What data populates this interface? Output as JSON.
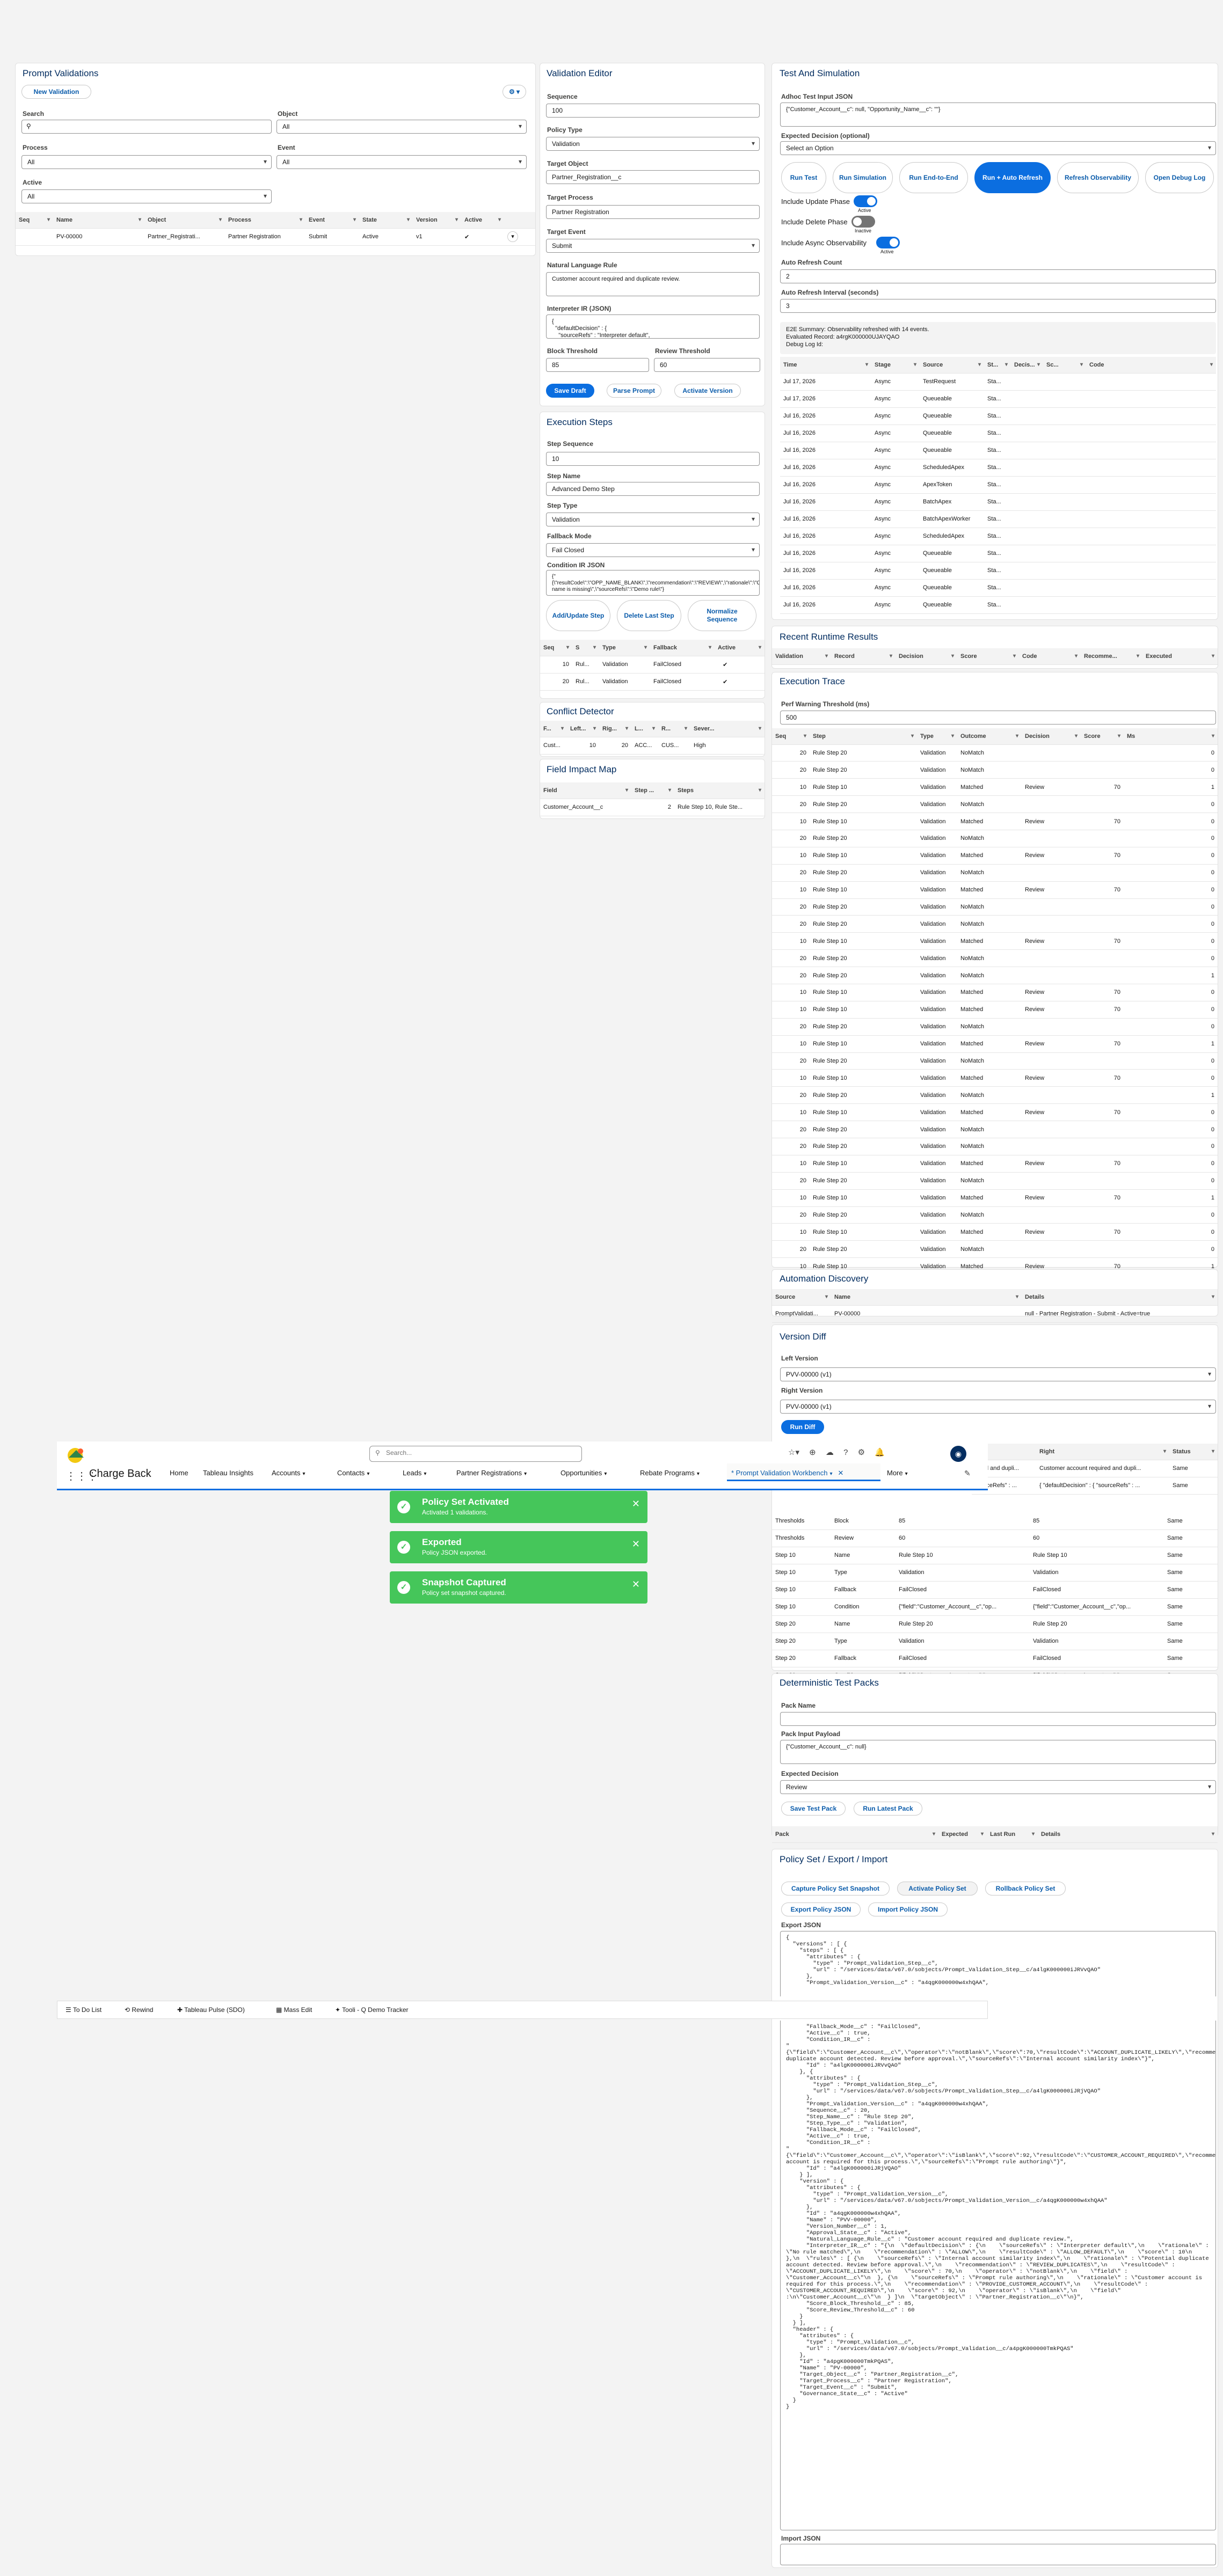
{
  "prompt_validations": {
    "title": "Prompt Validations",
    "new_button": "New Validation",
    "search_label": "Search",
    "search_value": "",
    "object_label": "Object",
    "object_value": "All",
    "process_label": "Process",
    "process_value": "All",
    "event_label": "Event",
    "event_value": "All",
    "active_label": "Active",
    "active_value": "All",
    "columns": [
      "Seq",
      "Name",
      "Object",
      "Process",
      "Event",
      "State",
      "Version",
      "Active"
    ],
    "row": {
      "seq": "",
      "name": "PV-00000",
      "object": "Partner_Registrati...",
      "process": "Partner Registration",
      "event": "Submit",
      "state": "Active",
      "version": "v1"
    }
  },
  "validation_editor": {
    "title": "Validation Editor",
    "sequence_label": "Sequence",
    "sequence_value": "100",
    "policy_type_label": "Policy Type",
    "policy_type_value": "Validation",
    "target_object_label": "Target Object",
    "target_object_value": "Partner_Registration__c",
    "target_process_label": "Target Process",
    "target_process_value": "Partner Registration",
    "target_event_label": "Target Event",
    "target_event_value": "Submit",
    "nl_rule_label": "Natural Language Rule",
    "nl_rule_value": "Customer account required and duplicate review.",
    "ir_label": "Interpreter IR (JSON)",
    "ir_value": "{\n  \"defaultDecision\" : {\n    \"sourceRefs\" : \"Interpreter default\",",
    "block_label": "Block Threshold",
    "block_value": "85",
    "review_label": "Review Threshold",
    "review_value": "60",
    "save_draft": "Save Draft",
    "parse_prompt": "Parse Prompt",
    "activate_version": "Activate Version"
  },
  "execution_steps": {
    "title": "Execution Steps",
    "step_seq_label": "Step Sequence",
    "step_seq_value": "10",
    "step_name_label": "Step Name",
    "step_name_value": "Advanced Demo Step",
    "step_type_label": "Step Type",
    "step_type_value": "Validation",
    "fallback_label": "Fallback Mode",
    "fallback_value": "Fail Closed",
    "condition_label": "Condition IR JSON",
    "condition_value": "{\"{\\\"resultCode\\\":\\\"OPP_NAME_BLANK\\\",\\\"recommendation\\\":\\\"REVIEW\\\",\\\"rationale\\\":\\\"Opportunity name is missing\\\",\\\"sourceRefs\\\":\\\"Demo rule\\\"}",
    "add_update": "Add/Update Step",
    "delete_last": "Delete Last Step",
    "normalize": "Normalize Sequence",
    "columns": [
      "Seq",
      "S",
      "Type",
      "Fallback",
      "Active"
    ],
    "rows": [
      {
        "seq": "10",
        "s": "Rul...",
        "type": "Validation",
        "fallback": "FailClosed"
      },
      {
        "seq": "20",
        "s": "Rul...",
        "type": "Validation",
        "fallback": "FailClosed"
      }
    ]
  },
  "conflict_detector": {
    "title": "Conflict Detector",
    "columns": [
      "F...",
      "Left...",
      "Rig...",
      "L...",
      "R...",
      "Sever..."
    ],
    "row": [
      "Cust...",
      "10",
      "20",
      "ACC...",
      "CUS...",
      "High"
    ]
  },
  "field_impact": {
    "title": "Field Impact Map",
    "columns": [
      "Field",
      "Step ...",
      "Steps"
    ],
    "row": [
      "Customer_Account__c",
      "2",
      "Rule Step 10, Rule Ste..."
    ]
  },
  "test_sim": {
    "title": "Test And Simulation",
    "adhoc_label": "Adhoc Test Input JSON",
    "adhoc_value": "{\"Customer_Account__c\": null, \"Opportunity_Name__c\": \"\"}",
    "expected_label": "Expected Decision (optional)",
    "expected_value": "Select an Option",
    "buttons": [
      "Run Test",
      "Run Simulation",
      "Run End-to-End",
      "Run + Auto Refresh",
      "Refresh Observability",
      "Open Debug Log"
    ],
    "include_update": "Include Update Phase",
    "include_delete": "Include Delete Phase",
    "include_async": "Include Async Observability",
    "active_text": "Active",
    "inactive_text": "Inactive",
    "auto_count_label": "Auto Refresh Count",
    "auto_count_value": "2",
    "auto_interval_label": "Auto Refresh Interval (seconds)",
    "auto_interval_value": "3",
    "e2e_summary": "E2E Summary: Observability refreshed with 14 events.",
    "evaluated_record": "Evaluated Record: a4rgK000000UJAYQAO",
    "debug_log": "Debug Log Id:",
    "obs_columns": [
      "Time",
      "Stage",
      "Source",
      "St...",
      "Decis...",
      "Sc...",
      "Code"
    ],
    "obs_rows": [
      [
        "Jul 17, 2026",
        "Async",
        "TestRequest",
        "Sta..."
      ],
      [
        "Jul 17, 2026",
        "Async",
        "Queueable",
        "Sta..."
      ],
      [
        "Jul 16, 2026",
        "Async",
        "Queueable",
        "Sta..."
      ],
      [
        "Jul 16, 2026",
        "Async",
        "Queueable",
        "Sta..."
      ],
      [
        "Jul 16, 2026",
        "Async",
        "Queueable",
        "Sta..."
      ],
      [
        "Jul 16, 2026",
        "Async",
        "ScheduledApex",
        "Sta..."
      ],
      [
        "Jul 16, 2026",
        "Async",
        "ApexToken",
        "Sta..."
      ],
      [
        "Jul 16, 2026",
        "Async",
        "BatchApex",
        "Sta..."
      ],
      [
        "Jul 16, 2026",
        "Async",
        "BatchApexWorker",
        "Sta..."
      ],
      [
        "Jul 16, 2026",
        "Async",
        "ScheduledApex",
        "Sta..."
      ],
      [
        "Jul 16, 2026",
        "Async",
        "Queueable",
        "Sta..."
      ],
      [
        "Jul 16, 2026",
        "Async",
        "Queueable",
        "Sta..."
      ],
      [
        "Jul 16, 2026",
        "Async",
        "Queueable",
        "Sta..."
      ],
      [
        "Jul 16, 2026",
        "Async",
        "Queueable",
        "Sta..."
      ]
    ]
  },
  "recent_results": {
    "title": "Recent Runtime Results",
    "columns": [
      "Validation",
      "Record",
      "Decision",
      "Score",
      "Code",
      "Recomme...",
      "Executed"
    ]
  },
  "execution_trace": {
    "title": "Execution Trace",
    "perf_label": "Perf Warning Threshold (ms)",
    "perf_value": "500",
    "columns": [
      "Seq",
      "Step",
      "Type",
      "Outcome",
      "Decision",
      "Score",
      "Ms"
    ],
    "rows": [
      [
        "20",
        "Rule Step 20",
        "Validation",
        "NoMatch",
        "",
        "",
        "0"
      ],
      [
        "20",
        "Rule Step 20",
        "Validation",
        "NoMatch",
        "",
        "",
        "0"
      ],
      [
        "10",
        "Rule Step 10",
        "Validation",
        "Matched",
        "Review",
        "70",
        "1"
      ],
      [
        "20",
        "Rule Step 20",
        "Validation",
        "NoMatch",
        "",
        "",
        "0"
      ],
      [
        "10",
        "Rule Step 10",
        "Validation",
        "Matched",
        "Review",
        "70",
        "0"
      ],
      [
        "20",
        "Rule Step 20",
        "Validation",
        "NoMatch",
        "",
        "",
        "0"
      ],
      [
        "10",
        "Rule Step 10",
        "Validation",
        "Matched",
        "Review",
        "70",
        "0"
      ],
      [
        "20",
        "Rule Step 20",
        "Validation",
        "NoMatch",
        "",
        "",
        "0"
      ],
      [
        "10",
        "Rule Step 10",
        "Validation",
        "Matched",
        "Review",
        "70",
        "0"
      ],
      [
        "20",
        "Rule Step 20",
        "Validation",
        "NoMatch",
        "",
        "",
        "0"
      ],
      [
        "20",
        "Rule Step 20",
        "Validation",
        "NoMatch",
        "",
        "",
        "0"
      ],
      [
        "10",
        "Rule Step 10",
        "Validation",
        "Matched",
        "Review",
        "70",
        "0"
      ],
      [
        "20",
        "Rule Step 20",
        "Validation",
        "NoMatch",
        "",
        "",
        "0"
      ],
      [
        "20",
        "Rule Step 20",
        "Validation",
        "NoMatch",
        "",
        "",
        "1"
      ],
      [
        "10",
        "Rule Step 10",
        "Validation",
        "Matched",
        "Review",
        "70",
        "0"
      ],
      [
        "10",
        "Rule Step 10",
        "Validation",
        "Matched",
        "Review",
        "70",
        "0"
      ],
      [
        "20",
        "Rule Step 20",
        "Validation",
        "NoMatch",
        "",
        "",
        "0"
      ],
      [
        "10",
        "Rule Step 10",
        "Validation",
        "Matched",
        "Review",
        "70",
        "1"
      ],
      [
        "20",
        "Rule Step 20",
        "Validation",
        "NoMatch",
        "",
        "",
        "0"
      ],
      [
        "10",
        "Rule Step 10",
        "Validation",
        "Matched",
        "Review",
        "70",
        "0"
      ],
      [
        "20",
        "Rule Step 20",
        "Validation",
        "NoMatch",
        "",
        "",
        "1"
      ],
      [
        "10",
        "Rule Step 10",
        "Validation",
        "Matched",
        "Review",
        "70",
        "0"
      ],
      [
        "20",
        "Rule Step 20",
        "Validation",
        "NoMatch",
        "",
        "",
        "0"
      ],
      [
        "20",
        "Rule Step 20",
        "Validation",
        "NoMatch",
        "",
        "",
        "0"
      ],
      [
        "10",
        "Rule Step 10",
        "Validation",
        "Matched",
        "Review",
        "70",
        "0"
      ],
      [
        "20",
        "Rule Step 20",
        "Validation",
        "NoMatch",
        "",
        "",
        "0"
      ],
      [
        "10",
        "Rule Step 10",
        "Validation",
        "Matched",
        "Review",
        "70",
        "1"
      ],
      [
        "20",
        "Rule Step 20",
        "Validation",
        "NoMatch",
        "",
        "",
        "0"
      ],
      [
        "10",
        "Rule Step 10",
        "Validation",
        "Matched",
        "Review",
        "70",
        "0"
      ],
      [
        "20",
        "Rule Step 20",
        "Validation",
        "NoMatch",
        "",
        "",
        "0"
      ],
      [
        "10",
        "Rule Step 10",
        "Validation",
        "Matched",
        "Review",
        "70",
        "1"
      ]
    ]
  },
  "automation_discovery": {
    "title": "Automation Discovery",
    "columns": [
      "Source",
      "Name",
      "Details"
    ],
    "row": [
      "PromptValidati...",
      "PV-00000",
      "null - Partner Registration - Submit - Active=true"
    ]
  },
  "version_diff": {
    "title": "Version Diff",
    "left_label": "Left Version",
    "left_value": "PVV-00000 (v1)",
    "right_label": "Right Version",
    "right_value": "PVV-00000 (v1)",
    "run_diff": "Run Diff",
    "columns": [
      "Right",
      "Status"
    ],
    "partial_rows": [
      [
        "...red and dupli...",
        "Customer account required and dupli...",
        "Same"
      ],
      [
        "sourceRefs\" : ...",
        "{ \"defaultDecision\" : { \"sourceRefs\" : ...",
        "Same"
      ]
    ],
    "rows": [
      [
        "Thresholds",
        "Block",
        "85",
        "85",
        "Same"
      ],
      [
        "Thresholds",
        "Review",
        "60",
        "60",
        "Same"
      ],
      [
        "Step 10",
        "Name",
        "Rule Step 10",
        "Rule Step 10",
        "Same"
      ],
      [
        "Step 10",
        "Type",
        "Validation",
        "Validation",
        "Same"
      ],
      [
        "Step 10",
        "Fallback",
        "FailClosed",
        "FailClosed",
        "Same"
      ],
      [
        "Step 10",
        "Condition",
        "{\"field\":\"Customer_Account__c\",\"op...",
        "{\"field\":\"Customer_Account__c\",\"op...",
        "Same"
      ],
      [
        "Step 20",
        "Name",
        "Rule Step 20",
        "Rule Step 20",
        "Same"
      ],
      [
        "Step 20",
        "Type",
        "Validation",
        "Validation",
        "Same"
      ],
      [
        "Step 20",
        "Fallback",
        "FailClosed",
        "FailClosed",
        "Same"
      ],
      [
        "Step 20",
        "Condition",
        "{\"field\":\"Customer_Account__c\",\"op...",
        "{\"field\":\"Customer_Account__c\",\"op...",
        "Same"
      ]
    ]
  },
  "test_packs": {
    "title": "Deterministic Test Packs",
    "pack_name_label": "Pack Name",
    "pack_name_value": "",
    "payload_label": "Pack Input Payload",
    "payload_value": "{\"Customer_Account__c\": null}",
    "expected_label": "Expected Decision",
    "expected_value": "Review",
    "save": "Save Test Pack",
    "run": "Run Latest Pack",
    "columns": [
      "Pack",
      "Expected",
      "Last Run",
      "Details"
    ]
  },
  "policy_set": {
    "title": "Policy Set / Export / Import",
    "buttons": [
      "Capture Policy Set Snapshot",
      "Activate Policy Set",
      "Rollback Policy Set",
      "Export Policy JSON",
      "Import Policy JSON"
    ],
    "export_label": "Export JSON",
    "export_top": "{\n  \"versions\" : [ {\n    \"steps\" : [ {\n      \"attributes\" : {\n        \"type\" : \"Prompt_Validation_Step__c\",\n        \"url\" : \"/services/data/v67.0/sobjects/Prompt_Validation_Step__c/a4lgK000000iJRVvQAO\"\n      },\n      \"Prompt_Validation_Version__c\" : \"a4qgK000000w4xhQAA\",",
    "export_body": "      \"Fallback_Mode__c\" : \"FailClosed\",\n      \"Active__c\" : true,\n      \"Condition_IR__c\" :\n\"{\\\"field\\\":\\\"Customer_Account__c\\\",\\\"operator\\\":\\\"notBlank\\\",\\\"score\\\":70,\\\"resultCode\\\":\\\"ACCOUNT_DUPLICATE_LIKELY\\\",\\\"recommendation\\\":\\\"REVIEW_DUPLICATES\\\",\\\"rationale\\\":\\\"Potential duplicate account detected. Review before approval.\\\",\\\"sourceRefs\\\":\\\"Internal account similarity index\\\"}\",\n      \"Id\" : \"a4lgK000000iJRVvQAO\"\n    }, {\n      \"attributes\" : {\n        \"type\" : \"Prompt_Validation_Step__c\",\n        \"url\" : \"/services/data/v67.0/sobjects/Prompt_Validation_Step__c/a4lgK000000iJRjVQAO\"\n      },\n      \"Prompt_Validation_Version__c\" : \"a4qgK000000w4xhQAA\",\n      \"Sequence__c\" : 20,\n      \"Step_Name__c\" : \"Rule Step 20\",\n      \"Step_Type__c\" : \"Validation\",\n      \"Fallback_Mode__c\" : \"FailClosed\",\n      \"Active__c\" : true,\n      \"Condition_IR__c\" :\n\"{\\\"field\\\":\\\"Customer_Account__c\\\",\\\"operator\\\":\\\"isBlank\\\",\\\"score\\\":92,\\\"resultCode\\\":\\\"CUSTOMER_ACCOUNT_REQUIRED\\\",\\\"recommendation\\\":\\\"PROVIDE_CUSTOMER_ACCOUNT\\\",\\\"rationale\\\":\\\"Customer account is required for this process.\\\",\\\"sourceRefs\\\":\\\"Prompt rule authoring\\\"}\",\n      \"Id\" : \"a4lgK000000iJRjVQAO\"\n    } ],\n    \"version\" : {\n      \"attributes\" : {\n        \"type\" : \"Prompt_Validation_Version__c\",\n        \"url\" : \"/services/data/v67.0/sobjects/Prompt_Validation_Version__c/a4qgK000000w4xhQAA\"\n      },\n      \"Id\" : \"a4qgK000000w4xhQAA\",\n      \"Name\" : \"PVV-00000\",\n      \"Version_Number__c\" : 1,\n      \"Approval_State__c\" : \"Active\",\n      \"Natural_Language_Rule__c\" : \"Customer account required and duplicate review.\",\n      \"Interpreter_IR__c\" : \"{\\n  \\\"defaultDecision\\\" : {\\n    \\\"sourceRefs\\\" : \\\"Interpreter default\\\",\\n    \\\"rationale\\\" : \\\"No rule matched\\\",\\n    \\\"recommendation\\\" : \\\"ALLOW\\\",\\n    \\\"resultCode\\\" : \\\"ALLOW_DEFAULT\\\",\\n    \\\"score\\\" : 10\\n  },\\n  \\\"rules\\\" : [ {\\n    \\\"sourceRefs\\\" : \\\"Internal account similarity index\\\",\\n    \\\"rationale\\\" : \\\"Potential duplicate account detected. Review before approval.\\\",\\n    \\\"recommendation\\\" : \\\"REVIEW_DUPLICATES\\\",\\n    \\\"resultCode\\\" : \\\"ACCOUNT_DUPLICATE_LIKELY\\\",\\n    \\\"score\\\" : 70,\\n    \\\"operator\\\" : \\\"notBlank\\\",\\n    \\\"field\\\" : \\\"Customer_Account__c\\\"\\n  }, {\\n    \\\"sourceRefs\\\" : \\\"Prompt rule authoring\\\",\\n    \\\"rationale\\\" : \\\"Customer account is required for this process.\\\",\\n    \\\"recommendation\\\" : \\\"PROVIDE_CUSTOMER_ACCOUNT\\\",\\n    \\\"resultCode\\\" : \\\"CUSTOMER_ACCOUNT_REQUIRED\\\",\\n    \\\"score\\\" : 92,\\n    \\\"operator\\\" : \\\"isBlank\\\",\\n    \\\"field\\\" :\\n\\\"Customer_Account__c\\\"\\n  } ]\\n  \\\"targetObject\\\" : \\\"Partner_Registration__c\\\"\\n}\",\n      \"Score_Block_Threshold__c\" : 85,\n      \"Score_Review_Threshold__c\" : 60\n    }\n  } ],\n  \"header\" : {\n    \"attributes\" : {\n      \"type\" : \"Prompt_Validation__c\",\n      \"url\" : \"/services/data/v67.0/sobjects/Prompt_Validation__c/a4pgK000000TmkPQAS\"\n    },\n    \"Id\" : \"a4pgK000000TmkPQAS\",\n    \"Name\" : \"PV-00000\",\n    \"Target_Object__c\" : \"Partner_Registration__c\",\n    \"Target_Process__c\" : \"Partner Registration\",\n    \"Target_Event__c\" : \"Submit\",\n    \"Governance_State__c\" : \"Active\"\n  }\n}",
    "import_label": "Import JSON",
    "import_value": ""
  },
  "nav": {
    "app_name": "Charge Back",
    "search_placeholder": "Search...",
    "tabs": [
      "Home",
      "Tableau Insights",
      "Accounts",
      "Contacts",
      "Leads",
      "Partner Registrations",
      "Opportunities",
      "Rebate Programs",
      "* Prompt Validation Workbench",
      "More"
    ]
  },
  "toasts": [
    {
      "title": "Policy Set Activated",
      "sub": "Activated 1 validations."
    },
    {
      "title": "Exported",
      "sub": "Policy JSON exported."
    },
    {
      "title": "Snapshot Captured",
      "sub": "Policy set snapshot captured."
    }
  ],
  "utility_bar": [
    "To Do List",
    "Rewind",
    "Tableau Pulse (SDO)",
    "Mass Edit",
    "Tooli - Q Demo Tracker"
  ],
  "colors": {
    "brand": "#0b6ee0",
    "toast": "#45c65a",
    "header_text": "#032d60"
  }
}
